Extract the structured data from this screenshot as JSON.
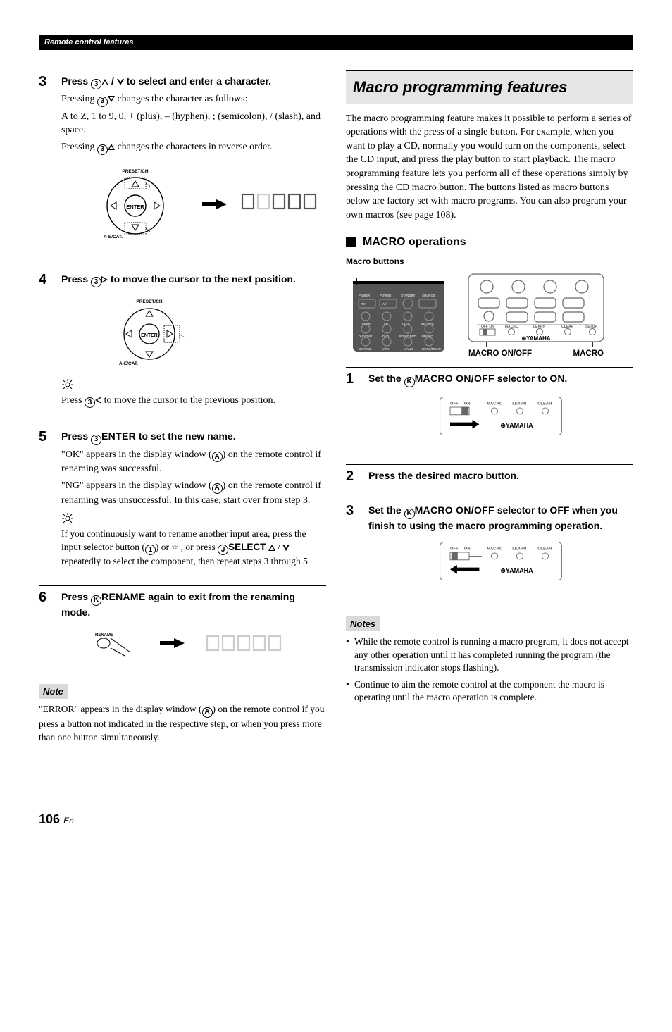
{
  "header": {
    "section_title": "Remote control features"
  },
  "left": {
    "step3": {
      "num": "3",
      "head_pre": "Press ",
      "head_mid": " / ",
      "head_post": " to select and enter a character.",
      "p1_pre": "Pressing ",
      "p1_post": " changes the character as follows:",
      "p2": "A to Z, 1 to 9, 0, + (plus), – (hyphen), ; (semicolon), / (slash), and space.",
      "p3_pre": "Pressing ",
      "p3_post": " changes the characters in reverse order.",
      "dial_up_label": "PRESET/CH",
      "dial_left_label": "A-E/CAT.",
      "dial_enter": "ENTER"
    },
    "step4": {
      "num": "4",
      "head_pre": "Press ",
      "head_post": " to move the cursor to the next position.",
      "dial_up_label": "PRESET/CH",
      "dial_left_label": "A-E/CAT.",
      "dial_enter": "ENTER",
      "tip_pre": "Press ",
      "tip_post": " to move the cursor to the previous position."
    },
    "step5": {
      "num": "5",
      "head_pre": "Press ",
      "enter_label": "ENTER",
      "head_post": " to set the new name.",
      "p1_pre": "\"OK\" appears in the display window (",
      "p1_post": ") on the remote control if renaming was successful.",
      "p2_pre": "\"NG\" appears in the display window (",
      "p2_post": ") on the remote control if renaming was unsuccessful. In this case, start over from step 3.",
      "tip_p_pre": "If you continuously want to rename another input area, press the input selector button (",
      "tip_p_mid1": ") or ",
      "tip_p_mid2": " , or press ",
      "select_label": "SELECT",
      "tip_p_mid3": " / ",
      "tip_p_post": " repeatedly to select the component, then repeat steps 3 through 5."
    },
    "step6": {
      "num": "6",
      "head_pre": "Press ",
      "rename_label": "RENAME",
      "head_post": " again to exit from the renaming mode.",
      "fig_label": "RENAME"
    },
    "note": {
      "label": "Note",
      "text_pre": "\"ERROR\" appears in the display window (",
      "text_post": ") on the remote control if you press a button not indicated in the respective step, or when you press more than one button simultaneously."
    }
  },
  "right": {
    "title": "Macro programming features",
    "intro": "The macro programming feature makes it possible to perform a series of operations with the press of a single button. For example, when you want to play a CD, normally you would turn on the components, select the CD input, and press the play button to start playback. The macro programming feature lets you perform all of these operations simply by pressing the CD macro button. The buttons listed as macro buttons below are factory set with macro programs. You can also program your own macros (see page 108).",
    "h3": "MACRO operations",
    "sub": "Macro buttons",
    "caption_onoff": "MACRO ON/OFF",
    "caption_macro": "MACRO",
    "step1": {
      "num": "1",
      "head_pre": "Set the ",
      "label": "MACRO ON/OFF",
      "head_post": " selector to ON."
    },
    "step2": {
      "num": "2",
      "head": "Press the desired macro button."
    },
    "step3": {
      "num": "3",
      "head_pre": "Set the ",
      "label": "MACRO ON/OFF",
      "head_post": " selector to OFF when you finish to using the macro programming operation."
    },
    "notes": {
      "label": "Notes",
      "items": [
        "While the remote control is running a macro program, it does not accept any other operation until it has completed running the program (the transmission indicator stops flashing).",
        "Continue to aim the remote control at the component the macro is operating until the macro operation is complete."
      ]
    },
    "selector_labels": {
      "off": "OFF",
      "on": "ON",
      "macro": "MACRO",
      "learn": "LEARN",
      "clear": "CLEAR",
      "yamaha": "YAMAHA"
    }
  },
  "page": {
    "num": "106",
    "lang": "En"
  },
  "circled": {
    "c1": "1",
    "c3": "3",
    "cJ": "J",
    "cA": "A",
    "cK": "K"
  }
}
